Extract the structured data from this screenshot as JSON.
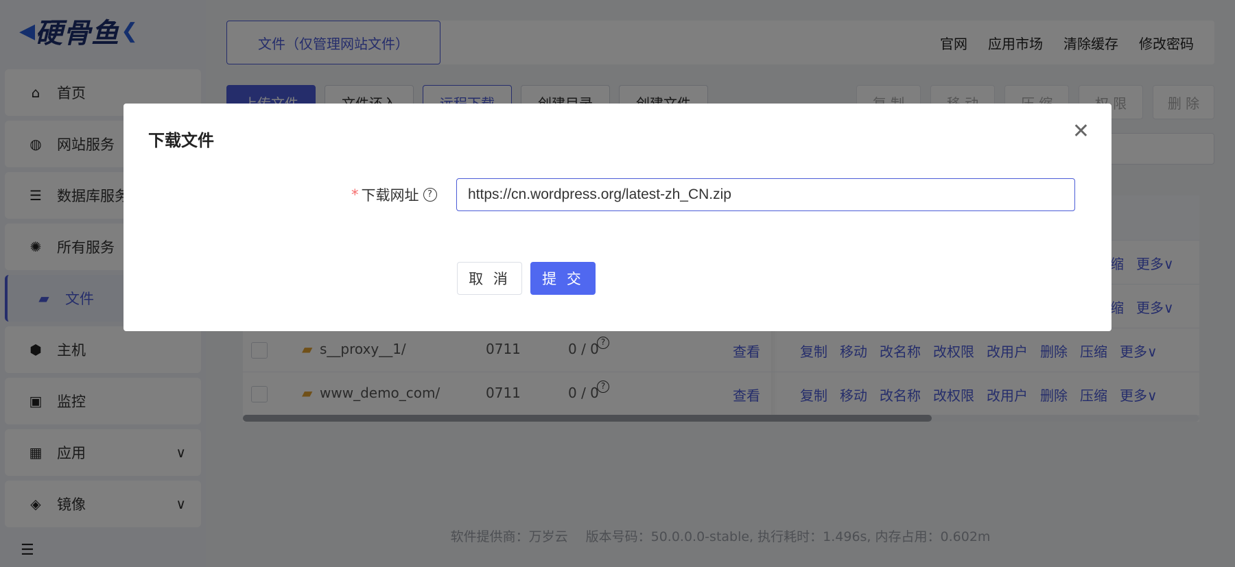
{
  "sidebar": {
    "logo": "硬骨鱼",
    "items": [
      {
        "label": "首页",
        "icon": "home-icon"
      },
      {
        "label": "网站服务",
        "icon": "globe-icon"
      },
      {
        "label": "数据库服务",
        "icon": "database-icon"
      },
      {
        "label": "所有服务",
        "icon": "services-icon"
      },
      {
        "label": "文件",
        "icon": "folder-open-icon"
      },
      {
        "label": "主机",
        "icon": "host-icon"
      },
      {
        "label": "监控",
        "icon": "monitor-icon"
      },
      {
        "label": "应用",
        "icon": "apps-grid-icon"
      },
      {
        "label": "镜像",
        "icon": "image-box-icon"
      }
    ]
  },
  "topbar": {
    "file_tab": "文件（仅管理网站文件）",
    "links": [
      "官网",
      "应用市场",
      "清除缓存",
      "修改密码"
    ]
  },
  "toolbar": {
    "left": [
      "上传文件",
      "文件还入",
      "远程下载",
      "创建目录",
      "创建文件"
    ],
    "right": [
      "复 制",
      "移 动",
      "压 缩",
      "权 限",
      "删 除"
    ]
  },
  "table": {
    "rows": [
      {
        "name": "s__proxy__1/",
        "perm": "0711",
        "owner": "0 / 0",
        "view": "查看"
      },
      {
        "name": "www_demo_com/",
        "perm": "0711",
        "owner": "0 / 0",
        "view": "查看"
      }
    ],
    "partial_ops": [
      "缩",
      "更多∨"
    ],
    "ops": [
      "复制",
      "移动",
      "改名称",
      "改权限",
      "改用户",
      "删除",
      "压缩",
      "更多∨"
    ]
  },
  "footer": {
    "vendor": "软件提供商：万岁云",
    "info": "版本号码：50.0.0.0-stable, 执行耗时：1.496s, 内存占用：0.602m"
  },
  "modal": {
    "title": "下载文件",
    "label": "下载网址",
    "required_mark": "*",
    "url_value": "https://cn.wordpress.org/latest-zh_CN.zip",
    "cancel": "取 消",
    "submit": "提 交"
  },
  "colors": {
    "accent": "#4a5bd6",
    "submit": "#5068f0",
    "folder": "#e0a030",
    "required": "#f56c6c"
  }
}
